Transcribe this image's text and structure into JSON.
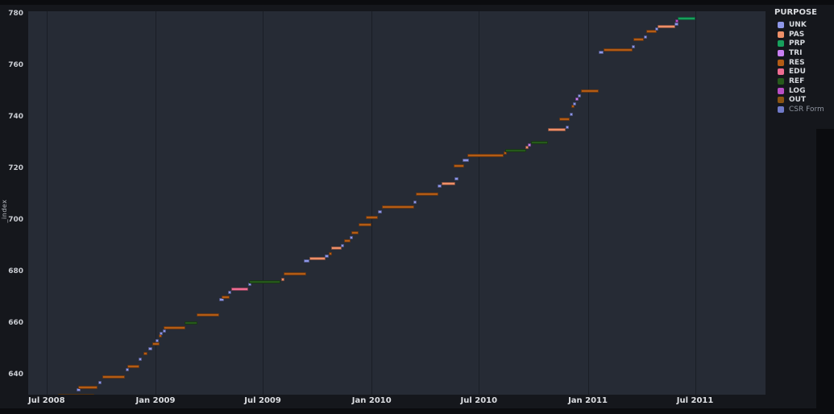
{
  "figure": {
    "background": "#15171c",
    "plot_background": "#262b35",
    "gridline_color": "#1a1e26"
  },
  "y_axis": {
    "label": "_index",
    "ticks": [
      640,
      660,
      680,
      700,
      720,
      740,
      760,
      780
    ]
  },
  "x_axis": {
    "ticks": [
      {
        "label": "Jul 2008",
        "date": "2008-07-01"
      },
      {
        "label": "Jan 2009",
        "date": "2009-01-01"
      },
      {
        "label": "Jul 2009",
        "date": "2009-07-01"
      },
      {
        "label": "Jan 2010",
        "date": "2010-01-01"
      },
      {
        "label": "Jul 2010",
        "date": "2010-07-01"
      },
      {
        "label": "Jan 2011",
        "date": "2011-01-01"
      },
      {
        "label": "Jul 2011",
        "date": "2011-07-01"
      }
    ]
  },
  "legend": {
    "title": "PURPOSE",
    "items": [
      {
        "label": "UNK",
        "color": "#8e97e8",
        "dim": false
      },
      {
        "label": "PAS",
        "color": "#ee8f68",
        "dim": false
      },
      {
        "label": "PRP",
        "color": "#17a05c",
        "dim": false
      },
      {
        "label": "TRI",
        "color": "#c97ff2",
        "dim": false
      },
      {
        "label": "RES",
        "color": "#b35c15",
        "dim": false
      },
      {
        "label": "EDU",
        "color": "#ef6d92",
        "dim": false
      },
      {
        "label": "REF",
        "color": "#265a1b",
        "dim": false
      },
      {
        "label": "LOG",
        "color": "#b94fc6",
        "dim": false
      },
      {
        "label": "OUT",
        "color": "#8b5413",
        "dim": false
      },
      {
        "label": "CSR Form",
        "color": "#707ac8",
        "dim": true
      }
    ]
  },
  "chart_data": {
    "type": "gantt",
    "title": "",
    "xlabel": "",
    "ylabel": "_index",
    "x_domain": [
      "2008-05-31",
      "2011-10-28"
    ],
    "y_domain": [
      632.2,
      780.9
    ],
    "grid": "vertical-only",
    "legend_position": "top-right-outside",
    "purpose_colors": {
      "UNK": "#8e97e8",
      "PAS": "#ee8f68",
      "PRP": "#17a05c",
      "TRI": "#c97ff2",
      "RES": "#b35c15",
      "EDU": "#ef6d92",
      "REF": "#265a1b",
      "LOG": "#b94fc6",
      "OUT": "#8b5413",
      "CSR Form": "#707ac8"
    },
    "segments": [
      {
        "index": 632,
        "purpose": "OUT",
        "start": "2008-07-21",
        "end": "2008-09-19"
      },
      {
        "index": 634,
        "purpose": "UNK",
        "start": "2008-08-21",
        "end": "2008-08-27"
      },
      {
        "index": 635,
        "purpose": "RES",
        "start": "2008-08-24",
        "end": "2008-09-25"
      },
      {
        "index": 637,
        "purpose": "UNK",
        "start": "2008-09-26",
        "end": "2008-10-02"
      },
      {
        "index": 639,
        "purpose": "RES",
        "start": "2008-10-03",
        "end": "2008-11-10"
      },
      {
        "index": 642,
        "purpose": "UNK",
        "start": "2008-11-12",
        "end": "2008-11-17"
      },
      {
        "index": 643,
        "purpose": "RES",
        "start": "2008-11-15",
        "end": "2008-12-05"
      },
      {
        "index": 646,
        "purpose": "UNK",
        "start": "2008-12-03",
        "end": "2008-12-08"
      },
      {
        "index": 648,
        "purpose": "RES",
        "start": "2008-12-11",
        "end": "2008-12-18"
      },
      {
        "index": 650,
        "purpose": "UNK",
        "start": "2008-12-20",
        "end": "2008-12-26"
      },
      {
        "index": 652,
        "purpose": "RES",
        "start": "2008-12-27",
        "end": "2009-01-08"
      },
      {
        "index": 653,
        "purpose": "UNK",
        "start": "2009-01-01",
        "end": "2009-01-06"
      },
      {
        "index": 655,
        "purpose": "RES",
        "start": "2009-01-07",
        "end": "2009-01-12"
      },
      {
        "index": 656,
        "purpose": "UNK",
        "start": "2009-01-08",
        "end": "2009-01-13"
      },
      {
        "index": 657,
        "purpose": "UNK",
        "start": "2009-01-13",
        "end": "2009-01-18"
      },
      {
        "index": 658,
        "purpose": "RES",
        "start": "2009-01-14",
        "end": "2009-02-20"
      },
      {
        "index": 660,
        "purpose": "REF",
        "start": "2009-02-19",
        "end": "2009-03-13"
      },
      {
        "index": 663,
        "purpose": "RES",
        "start": "2009-03-12",
        "end": "2009-04-19"
      },
      {
        "index": 669,
        "purpose": "UNK",
        "start": "2009-04-19",
        "end": "2009-04-26"
      },
      {
        "index": 670,
        "purpose": "RES",
        "start": "2009-04-23",
        "end": "2009-05-06"
      },
      {
        "index": 672,
        "purpose": "UNK",
        "start": "2009-05-03",
        "end": "2009-05-09"
      },
      {
        "index": 673,
        "purpose": "EDU",
        "start": "2009-05-09",
        "end": "2009-06-07"
      },
      {
        "index": 675,
        "purpose": "UNK",
        "start": "2009-06-06",
        "end": "2009-06-12"
      },
      {
        "index": 676,
        "purpose": "REF",
        "start": "2009-06-08",
        "end": "2009-07-31"
      },
      {
        "index": 677,
        "purpose": "PAS",
        "start": "2009-08-01",
        "end": "2009-08-06"
      },
      {
        "index": 679,
        "purpose": "RES",
        "start": "2009-08-06",
        "end": "2009-09-13"
      },
      {
        "index": 684,
        "purpose": "UNK",
        "start": "2009-09-08",
        "end": "2009-09-18"
      },
      {
        "index": 685,
        "purpose": "PAS",
        "start": "2009-09-18",
        "end": "2009-10-15"
      },
      {
        "index": 686,
        "purpose": "UNK",
        "start": "2009-10-14",
        "end": "2009-10-20"
      },
      {
        "index": 687,
        "purpose": "RES",
        "start": "2009-10-20",
        "end": "2009-10-25"
      },
      {
        "index": 689,
        "purpose": "PAS",
        "start": "2009-10-25",
        "end": "2009-11-11"
      },
      {
        "index": 690,
        "purpose": "UNK",
        "start": "2009-11-10",
        "end": "2009-11-16"
      },
      {
        "index": 692,
        "purpose": "RES",
        "start": "2009-11-16",
        "end": "2009-11-26"
      },
      {
        "index": 693,
        "purpose": "UNK",
        "start": "2009-11-25",
        "end": "2009-11-29"
      },
      {
        "index": 695,
        "purpose": "RES",
        "start": "2009-11-28",
        "end": "2009-12-10"
      },
      {
        "index": 698,
        "purpose": "RES",
        "start": "2009-12-10",
        "end": "2009-12-31"
      },
      {
        "index": 701,
        "purpose": "RES",
        "start": "2009-12-22",
        "end": "2010-01-11"
      },
      {
        "index": 703,
        "purpose": "UNK",
        "start": "2010-01-11",
        "end": "2010-01-18"
      },
      {
        "index": 705,
        "purpose": "RES",
        "start": "2010-01-18",
        "end": "2010-03-14"
      },
      {
        "index": 707,
        "purpose": "UNK",
        "start": "2010-03-12",
        "end": "2010-03-18"
      },
      {
        "index": 710,
        "purpose": "RES",
        "start": "2010-03-17",
        "end": "2010-04-24"
      },
      {
        "index": 713,
        "purpose": "UNK",
        "start": "2010-04-22",
        "end": "2010-04-29"
      },
      {
        "index": 714,
        "purpose": "PAS",
        "start": "2010-04-29",
        "end": "2010-05-22"
      },
      {
        "index": 716,
        "purpose": "UNK",
        "start": "2010-05-21",
        "end": "2010-05-27"
      },
      {
        "index": 721,
        "purpose": "RES",
        "start": "2010-05-20",
        "end": "2010-06-06"
      },
      {
        "index": 723,
        "purpose": "UNK",
        "start": "2010-06-04",
        "end": "2010-06-14"
      },
      {
        "index": 725,
        "purpose": "RES",
        "start": "2010-06-12",
        "end": "2010-08-12"
      },
      {
        "index": 726,
        "purpose": "RES",
        "start": "2010-08-12",
        "end": "2010-08-15"
      },
      {
        "index": 727,
        "purpose": "REF",
        "start": "2010-08-15",
        "end": "2010-09-19"
      },
      {
        "index": 728,
        "purpose": "PAS",
        "start": "2010-09-18",
        "end": "2010-09-22"
      },
      {
        "index": 729,
        "purpose": "TRI",
        "start": "2010-09-22",
        "end": "2010-09-26"
      },
      {
        "index": 730,
        "purpose": "REF",
        "start": "2010-09-27",
        "end": "2010-10-25"
      },
      {
        "index": 735,
        "purpose": "PAS",
        "start": "2010-10-25",
        "end": "2010-11-25"
      },
      {
        "index": 736,
        "purpose": "UNK",
        "start": "2010-11-24",
        "end": "2010-11-29"
      },
      {
        "index": 739,
        "purpose": "RES",
        "start": "2010-11-14",
        "end": "2010-12-02"
      },
      {
        "index": 741,
        "purpose": "UNK",
        "start": "2010-12-02",
        "end": "2010-12-06"
      },
      {
        "index": 744,
        "purpose": "RES",
        "start": "2010-12-04",
        "end": "2010-12-09"
      },
      {
        "index": 745,
        "purpose": "UNK",
        "start": "2010-12-07",
        "end": "2010-12-12"
      },
      {
        "index": 747,
        "purpose": "TRI",
        "start": "2010-12-11",
        "end": "2010-12-16"
      },
      {
        "index": 748,
        "purpose": "UNK",
        "start": "2010-12-15",
        "end": "2010-12-20"
      },
      {
        "index": 750,
        "purpose": "RES",
        "start": "2010-12-21",
        "end": "2011-01-19"
      },
      {
        "index": 765,
        "purpose": "UNK",
        "start": "2011-01-19",
        "end": "2011-01-27"
      },
      {
        "index": 766,
        "purpose": "RES",
        "start": "2011-01-27",
        "end": "2011-03-17"
      },
      {
        "index": 767,
        "purpose": "UNK",
        "start": "2011-03-16",
        "end": "2011-03-21"
      },
      {
        "index": 770,
        "purpose": "RES",
        "start": "2011-03-19",
        "end": "2011-04-06"
      },
      {
        "index": 771,
        "purpose": "UNK",
        "start": "2011-04-05",
        "end": "2011-04-10"
      },
      {
        "index": 773,
        "purpose": "RES",
        "start": "2011-04-09",
        "end": "2011-04-27"
      },
      {
        "index": 774,
        "purpose": "UNK",
        "start": "2011-04-24",
        "end": "2011-04-29"
      },
      {
        "index": 775,
        "purpose": "PAS",
        "start": "2011-04-29",
        "end": "2011-05-29"
      },
      {
        "index": 776,
        "purpose": "UNK",
        "start": "2011-05-27",
        "end": "2011-06-03"
      },
      {
        "index": 777,
        "purpose": "LOG",
        "start": "2011-05-29",
        "end": "2011-06-02"
      },
      {
        "index": 778,
        "purpose": "PRP",
        "start": "2011-06-02",
        "end": "2011-07-01"
      }
    ]
  }
}
